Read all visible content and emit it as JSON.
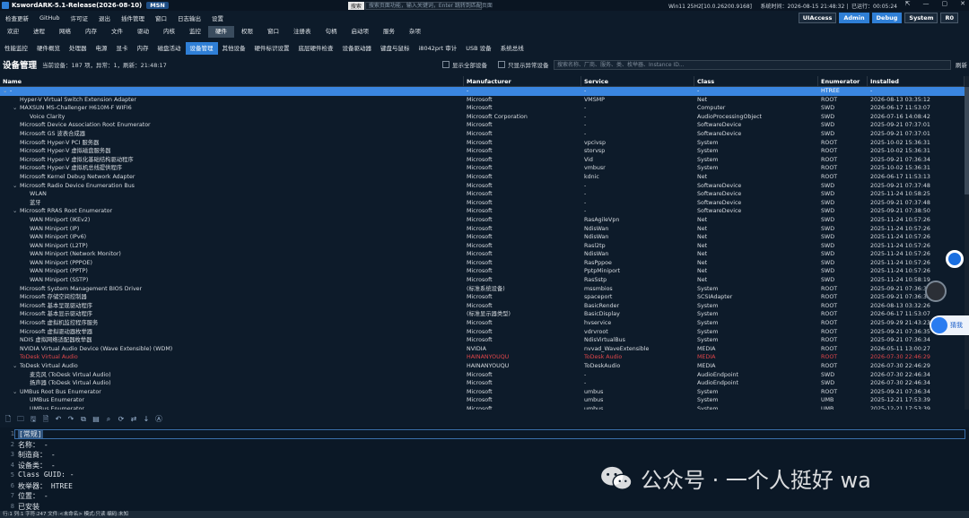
{
  "titlebar": {
    "title": "KswordARK-5.1-Release(2026-08-10)",
    "msn": "MSN",
    "search_label": "搜索",
    "search_placeholder": "搜索页面功能，输入关键词，Enter 跳转到匹配页面",
    "os": "Win11 25H2[10.0.26200.9168]",
    "systime": "系统时间：2026-08-15 21:48:32",
    "runtime": "已运行：00:05:24"
  },
  "menu": [
    "检查更新",
    "GitHub",
    "许可证",
    "退出",
    "插件管理",
    "窗口",
    "日志输出",
    "设置"
  ],
  "badges": [
    "UIAccess",
    "Admin",
    "Debug",
    "System",
    "R0"
  ],
  "tabs1": [
    "欢迎",
    "进程",
    "网络",
    "内存",
    "文件",
    "驱动",
    "内核",
    "监控",
    "硬件",
    "权限",
    "窗口",
    "注册表",
    "句柄",
    "启动项",
    "服务",
    "杂项"
  ],
  "tabs2": [
    "性能监控",
    "硬件概览",
    "处理器",
    "电源",
    "显卡",
    "内存",
    "磁盘活动",
    "设备管理",
    "其他设备",
    "硬件标识设置",
    "底层硬件检查",
    "设备驱动器",
    "键盘与鼠标",
    "i8042prt 审计",
    "USB 设备",
    "系统总线"
  ],
  "device": {
    "heading": "设备管理",
    "stats": "当前设备：187 项，异常：1，刷新：21:48:17",
    "show_all": "显示全部设备",
    "show_abnormal": "只显示异常设备",
    "filter_placeholder": "搜索名称、厂商、服务、类、枚举器、Instance ID...",
    "refresh": "刷新"
  },
  "columns": [
    "Name",
    "Manufacturer",
    "Service",
    "Class",
    "Enumerator",
    "Installed"
  ],
  "rows": [
    {
      "indent": 0,
      "arrow": "⌄",
      "name": "-",
      "mfr": "-",
      "svc": "-",
      "cls": "-",
      "enum": "HTREE",
      "inst": "-",
      "sel": true
    },
    {
      "indent": 1,
      "arrow": "",
      "name": "Hyper-V Virtual Switch Extension Adapter",
      "mfr": "Microsoft",
      "svc": "VMSMP",
      "cls": "Net",
      "enum": "ROOT",
      "inst": "2026-08-13 03:35:12"
    },
    {
      "indent": 1,
      "arrow": "⌄",
      "name": "MAXSUN MS-Challenger H610M-F WIFI6",
      "mfr": "Microsoft",
      "svc": "-",
      "cls": "Computer",
      "enum": "SWD",
      "inst": "2026-06-17 11:53:07"
    },
    {
      "indent": 2,
      "arrow": "",
      "name": "Voice Clarity",
      "mfr": "Microsoft Corporation",
      "svc": "-",
      "cls": "AudioProcessingObject",
      "enum": "SWD",
      "inst": "2026-07-16 14:08:42"
    },
    {
      "indent": 1,
      "arrow": "",
      "name": "Microsoft Device Association Root Enumerator",
      "mfr": "Microsoft",
      "svc": "-",
      "cls": "SoftwareDevice",
      "enum": "SWD",
      "inst": "2025-09-21 07:37:01"
    },
    {
      "indent": 1,
      "arrow": "",
      "name": "Microsoft GS 波表合成器",
      "mfr": "Microsoft",
      "svc": "-",
      "cls": "SoftwareDevice",
      "enum": "SWD",
      "inst": "2025-09-21 07:37:01"
    },
    {
      "indent": 1,
      "arrow": "",
      "name": "Microsoft Hyper-V PCI 服务器",
      "mfr": "Microsoft",
      "svc": "vpcivsp",
      "cls": "System",
      "enum": "ROOT",
      "inst": "2025-10-02 15:36:31"
    },
    {
      "indent": 1,
      "arrow": "",
      "name": "Microsoft Hyper-V 虚拟磁盘服务器",
      "mfr": "Microsoft",
      "svc": "storvsp",
      "cls": "System",
      "enum": "ROOT",
      "inst": "2025-10-02 15:36:31"
    },
    {
      "indent": 1,
      "arrow": "",
      "name": "Microsoft Hyper-V 虚拟化基础结构驱动程序",
      "mfr": "Microsoft",
      "svc": "Vid",
      "cls": "System",
      "enum": "ROOT",
      "inst": "2025-09-21 07:36:34"
    },
    {
      "indent": 1,
      "arrow": "",
      "name": "Microsoft Hyper-V 虚拟机总线提供程序",
      "mfr": "Microsoft",
      "svc": "vmbusr",
      "cls": "System",
      "enum": "ROOT",
      "inst": "2025-10-02 15:36:31"
    },
    {
      "indent": 1,
      "arrow": "",
      "name": "Microsoft Kernel Debug Network Adapter",
      "mfr": "Microsoft",
      "svc": "kdnic",
      "cls": "Net",
      "enum": "ROOT",
      "inst": "2026-06-17 11:53:13"
    },
    {
      "indent": 1,
      "arrow": "⌄",
      "name": "Microsoft Radio Device Enumeration Bus",
      "mfr": "Microsoft",
      "svc": "-",
      "cls": "SoftwareDevice",
      "enum": "SWD",
      "inst": "2025-09-21 07:37:48"
    },
    {
      "indent": 2,
      "arrow": "",
      "name": "WLAN",
      "mfr": "Microsoft",
      "svc": "-",
      "cls": "SoftwareDevice",
      "enum": "SWD",
      "inst": "2025-11-24 10:58:25"
    },
    {
      "indent": 2,
      "arrow": "",
      "name": "蓝牙",
      "mfr": "Microsoft",
      "svc": "-",
      "cls": "SoftwareDevice",
      "enum": "SWD",
      "inst": "2025-09-21 07:37:48"
    },
    {
      "indent": 1,
      "arrow": "⌄",
      "name": "Microsoft RRAS Root Enumerator",
      "mfr": "Microsoft",
      "svc": "-",
      "cls": "SoftwareDevice",
      "enum": "SWD",
      "inst": "2025-09-21 07:38:50"
    },
    {
      "indent": 2,
      "arrow": "",
      "name": "WAN Miniport (IKEv2)",
      "mfr": "Microsoft",
      "svc": "RasAgileVpn",
      "cls": "Net",
      "enum": "SWD",
      "inst": "2025-11-24 10:57:26"
    },
    {
      "indent": 2,
      "arrow": "",
      "name": "WAN Miniport (IP)",
      "mfr": "Microsoft",
      "svc": "NdisWan",
      "cls": "Net",
      "enum": "SWD",
      "inst": "2025-11-24 10:57:26"
    },
    {
      "indent": 2,
      "arrow": "",
      "name": "WAN Miniport (IPv6)",
      "mfr": "Microsoft",
      "svc": "NdisWan",
      "cls": "Net",
      "enum": "SWD",
      "inst": "2025-11-24 10:57:26"
    },
    {
      "indent": 2,
      "arrow": "",
      "name": "WAN Miniport (L2TP)",
      "mfr": "Microsoft",
      "svc": "Rasl2tp",
      "cls": "Net",
      "enum": "SWD",
      "inst": "2025-11-24 10:57:26"
    },
    {
      "indent": 2,
      "arrow": "",
      "name": "WAN Miniport (Network Monitor)",
      "mfr": "Microsoft",
      "svc": "NdisWan",
      "cls": "Net",
      "enum": "SWD",
      "inst": "2025-11-24 10:57:26"
    },
    {
      "indent": 2,
      "arrow": "",
      "name": "WAN Miniport (PPPOE)",
      "mfr": "Microsoft",
      "svc": "RasPppoe",
      "cls": "Net",
      "enum": "SWD",
      "inst": "2025-11-24 10:57:26"
    },
    {
      "indent": 2,
      "arrow": "",
      "name": "WAN Miniport (PPTP)",
      "mfr": "Microsoft",
      "svc": "PptpMiniport",
      "cls": "Net",
      "enum": "SWD",
      "inst": "2025-11-24 10:57:26"
    },
    {
      "indent": 2,
      "arrow": "",
      "name": "WAN Miniport (SSTP)",
      "mfr": "Microsoft",
      "svc": "RasSstp",
      "cls": "Net",
      "enum": "SWD",
      "inst": "2025-11-24 10:58:19"
    },
    {
      "indent": 1,
      "arrow": "",
      "name": "Microsoft System Management BIOS Driver",
      "mfr": "(标准系统设备)",
      "svc": "mssmbios",
      "cls": "System",
      "enum": "ROOT",
      "inst": "2025-09-21 07:36:35"
    },
    {
      "indent": 1,
      "arrow": "",
      "name": "Microsoft 存储空间控制器",
      "mfr": "Microsoft",
      "svc": "spaceport",
      "cls": "SCSIAdapter",
      "enum": "ROOT",
      "inst": "2025-09-21 07:36:35"
    },
    {
      "indent": 1,
      "arrow": "",
      "name": "Microsoft 基本呈现驱动程序",
      "mfr": "Microsoft",
      "svc": "BasicRender",
      "cls": "System",
      "enum": "ROOT",
      "inst": "2026-08-13 03:32:26"
    },
    {
      "indent": 1,
      "arrow": "",
      "name": "Microsoft 基本显示驱动程序",
      "mfr": "(标准显示器类型)",
      "svc": "BasicDisplay",
      "cls": "System",
      "enum": "ROOT",
      "inst": "2026-06-17 11:53:07"
    },
    {
      "indent": 1,
      "arrow": "",
      "name": "Microsoft 虚拟机监控程序服务",
      "mfr": "Microsoft",
      "svc": "hvservice",
      "cls": "System",
      "enum": "ROOT",
      "inst": "2025-09-29 21:43:23"
    },
    {
      "indent": 1,
      "arrow": "",
      "name": "Microsoft 虚拟驱动器枚举器",
      "mfr": "Microsoft",
      "svc": "vdrvroot",
      "cls": "System",
      "enum": "ROOT",
      "inst": "2025-09-21 07:36:35"
    },
    {
      "indent": 1,
      "arrow": "",
      "name": "NDIS 虚拟网络适配器枚举器",
      "mfr": "Microsoft",
      "svc": "NdisVirtualBus",
      "cls": "System",
      "enum": "ROOT",
      "inst": "2025-09-21 07:36:34"
    },
    {
      "indent": 1,
      "arrow": "",
      "name": "NVIDIA Virtual Audio Device (Wave Extensible) (WDM)",
      "mfr": "NVIDIA",
      "svc": "nvvad_WaveExtensible",
      "cls": "MEDIA",
      "enum": "ROOT",
      "inst": "2026-05-11 13:00:27"
    },
    {
      "indent": 1,
      "arrow": "",
      "name": "ToDesk Virtual Audio",
      "mfr": "HAINANYOUQU",
      "svc": "ToDesk Audio",
      "cls": "MEDIA",
      "enum": "ROOT",
      "inst": "2026-07-30 22:46:29",
      "red": true
    },
    {
      "indent": 1,
      "arrow": "⌄",
      "name": "ToDesk Virtual Audio",
      "mfr": "HAINANYOUQU",
      "svc": "ToDeskAudio",
      "cls": "MEDIA",
      "enum": "ROOT",
      "inst": "2026-07-30 22:46:29"
    },
    {
      "indent": 2,
      "arrow": "",
      "name": "麦克风 (ToDesk Virtual Audio)",
      "mfr": "Microsoft",
      "svc": "-",
      "cls": "AudioEndpoint",
      "enum": "SWD",
      "inst": "2026-07-30 22:46:34"
    },
    {
      "indent": 2,
      "arrow": "",
      "name": "扬声器 (ToDesk Virtual Audio)",
      "mfr": "Microsoft",
      "svc": "-",
      "cls": "AudioEndpoint",
      "enum": "SWD",
      "inst": "2026-07-30 22:46:34"
    },
    {
      "indent": 1,
      "arrow": "⌄",
      "name": "UMBus Root Bus Enumerator",
      "mfr": "Microsoft",
      "svc": "umbus",
      "cls": "System",
      "enum": "ROOT",
      "inst": "2025-09-21 07:36:34"
    },
    {
      "indent": 2,
      "arrow": "",
      "name": "UMBus Enumerator",
      "mfr": "Microsoft",
      "svc": "umbus",
      "cls": "System",
      "enum": "UMB",
      "inst": "2025-12-21 17:53:39"
    },
    {
      "indent": 2,
      "arrow": "",
      "name": "UMBus Enumerator",
      "mfr": "Microsoft",
      "svc": "umbus",
      "cls": "System",
      "enum": "UMB",
      "inst": "2025-12-21 17:53:39"
    }
  ],
  "editor": {
    "lines": [
      "[常规]",
      "名称： -",
      "制造商： -",
      "设备类： -",
      "Class GUID: -",
      "枚举器： HTREE",
      "位置： -",
      "已安装"
    ],
    "line_numbers": [
      "1",
      "2",
      "3",
      "4",
      "5",
      "6",
      "7",
      "8"
    ]
  },
  "status": "行:1 列:1 字符:247 文件:<未命名> 模式:只读 编码:未知",
  "watermark": "公众号 · 一个人挺好 wa",
  "float_label": "猜我"
}
